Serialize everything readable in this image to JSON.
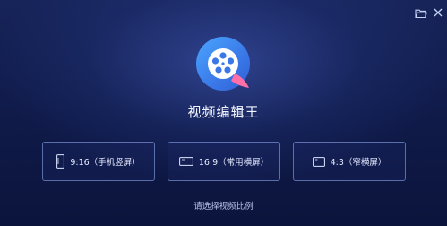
{
  "app": {
    "title": "视频编辑王"
  },
  "toolbar": {
    "folder_icon": "folder-open-icon",
    "close_icon": "close-icon"
  },
  "ratios": [
    {
      "label": "9:16（手机竖屏）",
      "icon": "portrait-phone-icon"
    },
    {
      "label": "16:9（常用横屏）",
      "icon": "landscape-screen-icon"
    },
    {
      "label": "4:3（窄横屏）",
      "icon": "narrow-landscape-icon"
    }
  ],
  "hint": "请选择视频比例",
  "colors": {
    "background_top": "#17245a",
    "background_bottom": "#0b143b",
    "logo_blue": "#3f8bf0",
    "logo_pink": "#ff6fa8",
    "button_border": "#8ca5eb"
  }
}
